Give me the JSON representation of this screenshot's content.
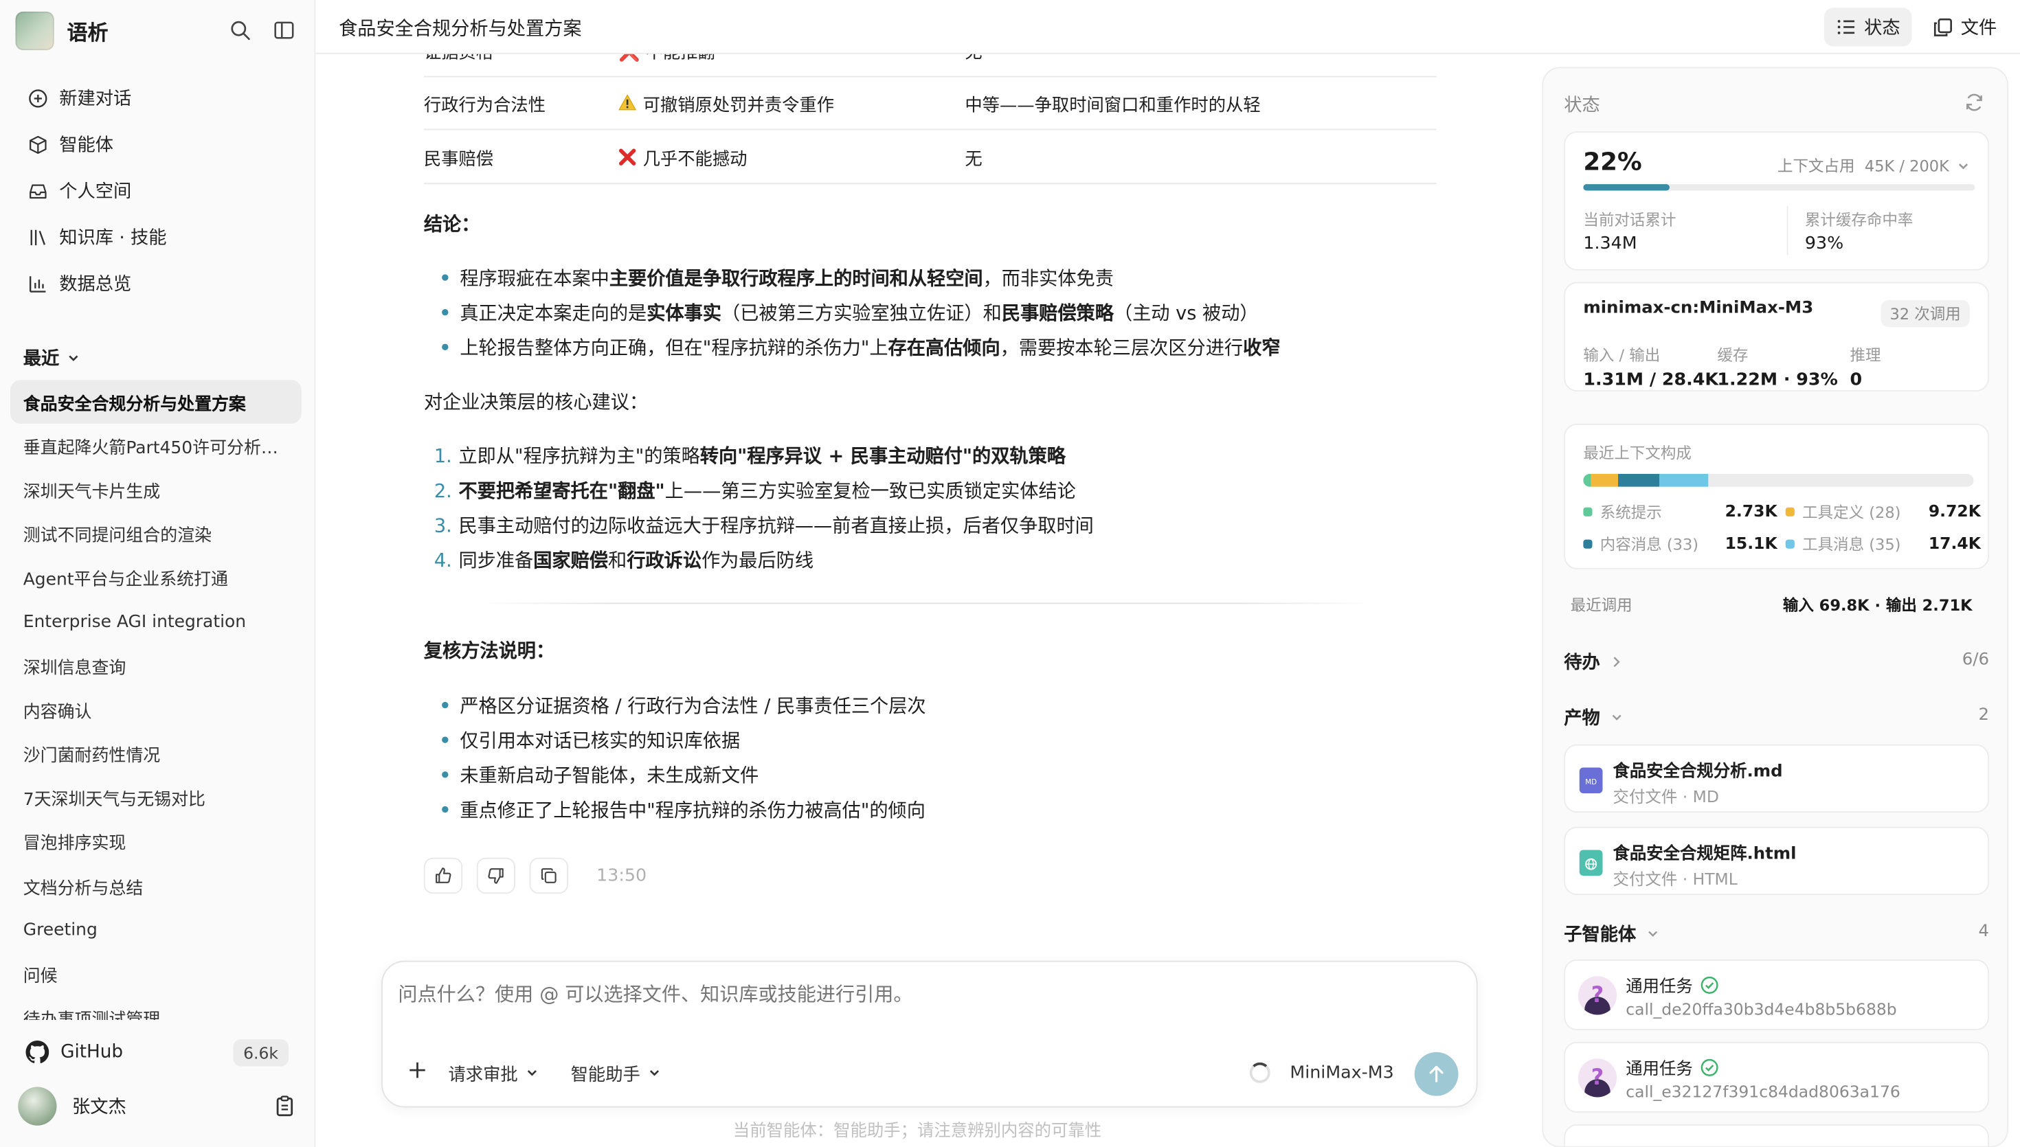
{
  "app": {
    "name": "语析"
  },
  "nav": [
    {
      "label": "新建对话",
      "icon": "plus-circle-icon"
    },
    {
      "label": "智能体",
      "icon": "cube-icon"
    },
    {
      "label": "个人空间",
      "icon": "inbox-icon"
    },
    {
      "label": "知识库 · 技能",
      "icon": "library-icon"
    },
    {
      "label": "数据总览",
      "icon": "bar-chart-icon"
    }
  ],
  "recent": {
    "heading": "最近",
    "items": [
      "食品安全合规分析与处置方案",
      "垂直起降火箭Part450许可分析…",
      "深圳天气卡片生成",
      "测试不同提问组合的渲染",
      "Agent平台与企业系统打通",
      "Enterprise AGI integration",
      "深圳信息查询",
      "内容确认",
      "沙门菌耐药性情况",
      "7天深圳天气与无锡对比",
      "冒泡排序实现",
      "文档分析与总结",
      "Greeting",
      "问候",
      "待办事项测试管理"
    ]
  },
  "github": {
    "label": "GitHub",
    "stars": "6.6k"
  },
  "user": {
    "name": "张文杰"
  },
  "header": {
    "title": "食品安全合规分析与处置方案",
    "status_btn": "状态",
    "files_btn": "文件"
  },
  "table": {
    "partial_row": {
      "c1": "证据资格",
      "c2": "❌ 不能推翻",
      "c3": "无"
    },
    "rows": [
      {
        "c1": "行政行为合法性",
        "icon": "⚠️",
        "c2": "可撤销原处罚并责令重作",
        "c3": "中等——争取时间窗口和重作时的从轻"
      },
      {
        "c1": "民事赔偿",
        "icon": "❌",
        "c2": "几乎不能撼动",
        "c3": "无"
      }
    ]
  },
  "conclusion": {
    "heading": "结论：",
    "bullets": [
      {
        "parts": [
          "程序瑕疵在本案中",
          "主要价值是争取行政程序上的时间和从轻空间",
          "，而非实体免责"
        ]
      },
      {
        "parts": [
          "真正决定本案走向的是",
          "实体事实",
          "（已被第三方实验室独立佐证）和",
          "民事赔偿策略",
          "（主动 vs 被动）"
        ]
      },
      {
        "parts": [
          "上轮报告整体方向正确，但在\"程序抗辩的杀伤力\"上",
          "存在高估倾向",
          "，需要按本轮三层次区分进行",
          "收窄",
          ""
        ]
      }
    ]
  },
  "advice": {
    "heading": "对企业决策层的核心建议：",
    "items": [
      {
        "n": "1.",
        "parts": [
          "立即从\"程序抗辩为主\"的策略",
          "转向\"程序异议 + 民事主动赔付\"的双轨策略",
          ""
        ]
      },
      {
        "n": "2.",
        "parts": [
          "",
          "不要把希望寄托在\"翻盘\"",
          "上——第三方实验室复检一致已实质锁定实体结论"
        ]
      },
      {
        "n": "3.",
        "parts": [
          "民事主动赔付的边际收益远大于程序抗辩——前者直接止损，后者仅争取时间",
          "",
          ""
        ]
      },
      {
        "n": "4.",
        "parts": [
          "同步准备",
          "国家赔偿",
          "和",
          "行政诉讼",
          "作为最后防线"
        ]
      }
    ]
  },
  "method": {
    "heading": "复核方法说明：",
    "bullets": [
      "严格区分证据资格 / 行政行为合法性 / 民事责任三个层次",
      "仅引用本对话已核实的知识库依据",
      "未重新启动子智能体，未生成新文件",
      "重点修正了上轮报告中\"程序抗辩的杀伤力被高估\"的倾向"
    ]
  },
  "message_time": "13:50",
  "composer": {
    "placeholder": "问点什么？使用 @ 可以选择文件、知识库或技能进行引用。",
    "approval": "请求审批",
    "assistant": "智能助手",
    "model": "MiniMax-M3",
    "footnote": "当前智能体：智能助手；请注意辨别内容的可靠性"
  },
  "status": {
    "title": "状态",
    "usage_pct": "22%",
    "usage_fraction": 0.22,
    "ctx_label": "上下文占用",
    "ctx_value": "45K / 200K",
    "total_label": "当前对话累计",
    "total_value": "1.34M",
    "cache_label": "累计缓存命中率",
    "cache_value": "93%",
    "model_name": "minimax-cn:MiniMax-M3",
    "calls": "32 次调用",
    "io_label": "输入 / 输出",
    "io_value": "1.31M / 28.4K",
    "cached_label": "缓存",
    "cached_value": "1.22M · 93%",
    "reason_label": "推理",
    "reason_value": "0",
    "composition_label": "最近上下文构成",
    "composition": [
      {
        "name": "系统提示",
        "value": "2.73K",
        "color": "#5fc99a",
        "share": 0.06
      },
      {
        "name": "工具定义 (28)",
        "value": "9.72K",
        "color": "#f0b93a",
        "share": 0.216
      },
      {
        "name": "内容消息 (33)",
        "value": "15.1K",
        "color": "#2e7f9b",
        "share": 0.336
      },
      {
        "name": "工具消息 (35)",
        "value": "17.4K",
        "color": "#6fc6e6",
        "share": 0.387
      }
    ],
    "recent_call_label": "最近调用",
    "recent_call_value": "输入 69.8K · 输出 2.71K"
  },
  "todo": {
    "label": "待办",
    "count": "6/6"
  },
  "artifacts": {
    "label": "产物",
    "count": "2",
    "files": [
      {
        "name": "食品安全合规分析.md",
        "sub": "交付文件 · MD",
        "color": "#6a6fd8"
      },
      {
        "name": "食品安全合规矩阵.html",
        "sub": "交付文件 · HTML",
        "color": "#4fbfae"
      }
    ]
  },
  "subagents": {
    "label": "子智能体",
    "count": "4",
    "items": [
      {
        "name": "通用任务",
        "id": "call_de20ffa30b3d4e4b8b5b688b"
      },
      {
        "name": "通用任务",
        "id": "call_e32127f391c84dad8063a176"
      }
    ]
  }
}
